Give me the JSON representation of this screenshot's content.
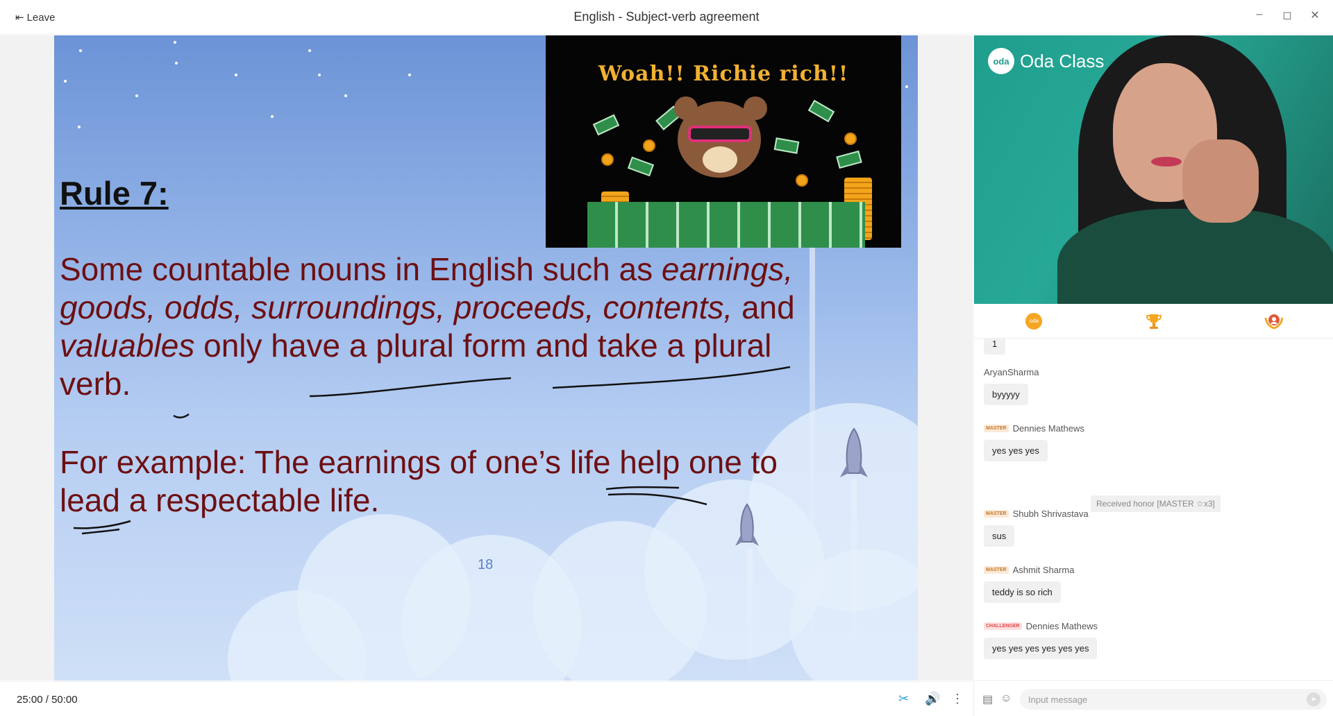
{
  "window": {
    "leave_label": "Leave",
    "title": "English - Subject-verb agreement",
    "controls": {
      "minimize": "–",
      "maximize": "◻",
      "close": "✕"
    }
  },
  "slide": {
    "rule_heading": "Rule 7:",
    "body_plain_1": "Some countable nouns in English such as ",
    "body_italic_1": "earnings, goods, odds, surroundings, proceeds, contents,",
    "body_plain_2": " and ",
    "body_italic_2": "valuables",
    "body_plain_3": " only have a plural form and take a plural verb.",
    "example": "For example: The earnings of one’s life help one to lead a respectable life.",
    "page_number": "18",
    "gif_caption": "Woah!! Richie rich!!",
    "text_color": "#6d0f12"
  },
  "playback": {
    "elapsed": "25:00",
    "separator": "/",
    "total": "50:00"
  },
  "video": {
    "brand_logo": "oda",
    "brand_name": "Oda Class"
  },
  "tabs": [
    {
      "name": "oda-coin-icon",
      "label": "oda"
    },
    {
      "name": "trophy-icon"
    },
    {
      "name": "honor-badge-icon"
    }
  ],
  "chat": {
    "messages": [
      {
        "author": "",
        "badge": "",
        "text": "1"
      },
      {
        "author": "AryanSharma",
        "badge": "",
        "text": "byyyyy"
      },
      {
        "author": "Dennies Mathews",
        "badge": "MASTER",
        "text": "yes yes yes"
      },
      {
        "author": "Shubh Shrivastava",
        "badge": "MASTER",
        "text": "sus"
      },
      {
        "author": "Ashmit Sharma",
        "badge": "MASTER",
        "text": "teddy is so rich"
      },
      {
        "author": "Dennies Mathews",
        "badge": "CHALLENGER",
        "text": "yes yes yes yes yes yes"
      }
    ],
    "system_notice": "Received honor [MASTER ☆x3]"
  },
  "input": {
    "placeholder": "Input message"
  },
  "colors": {
    "accent": "#1f9e8d",
    "master_badge": "#c4772a",
    "challenger_badge": "#e04848"
  }
}
